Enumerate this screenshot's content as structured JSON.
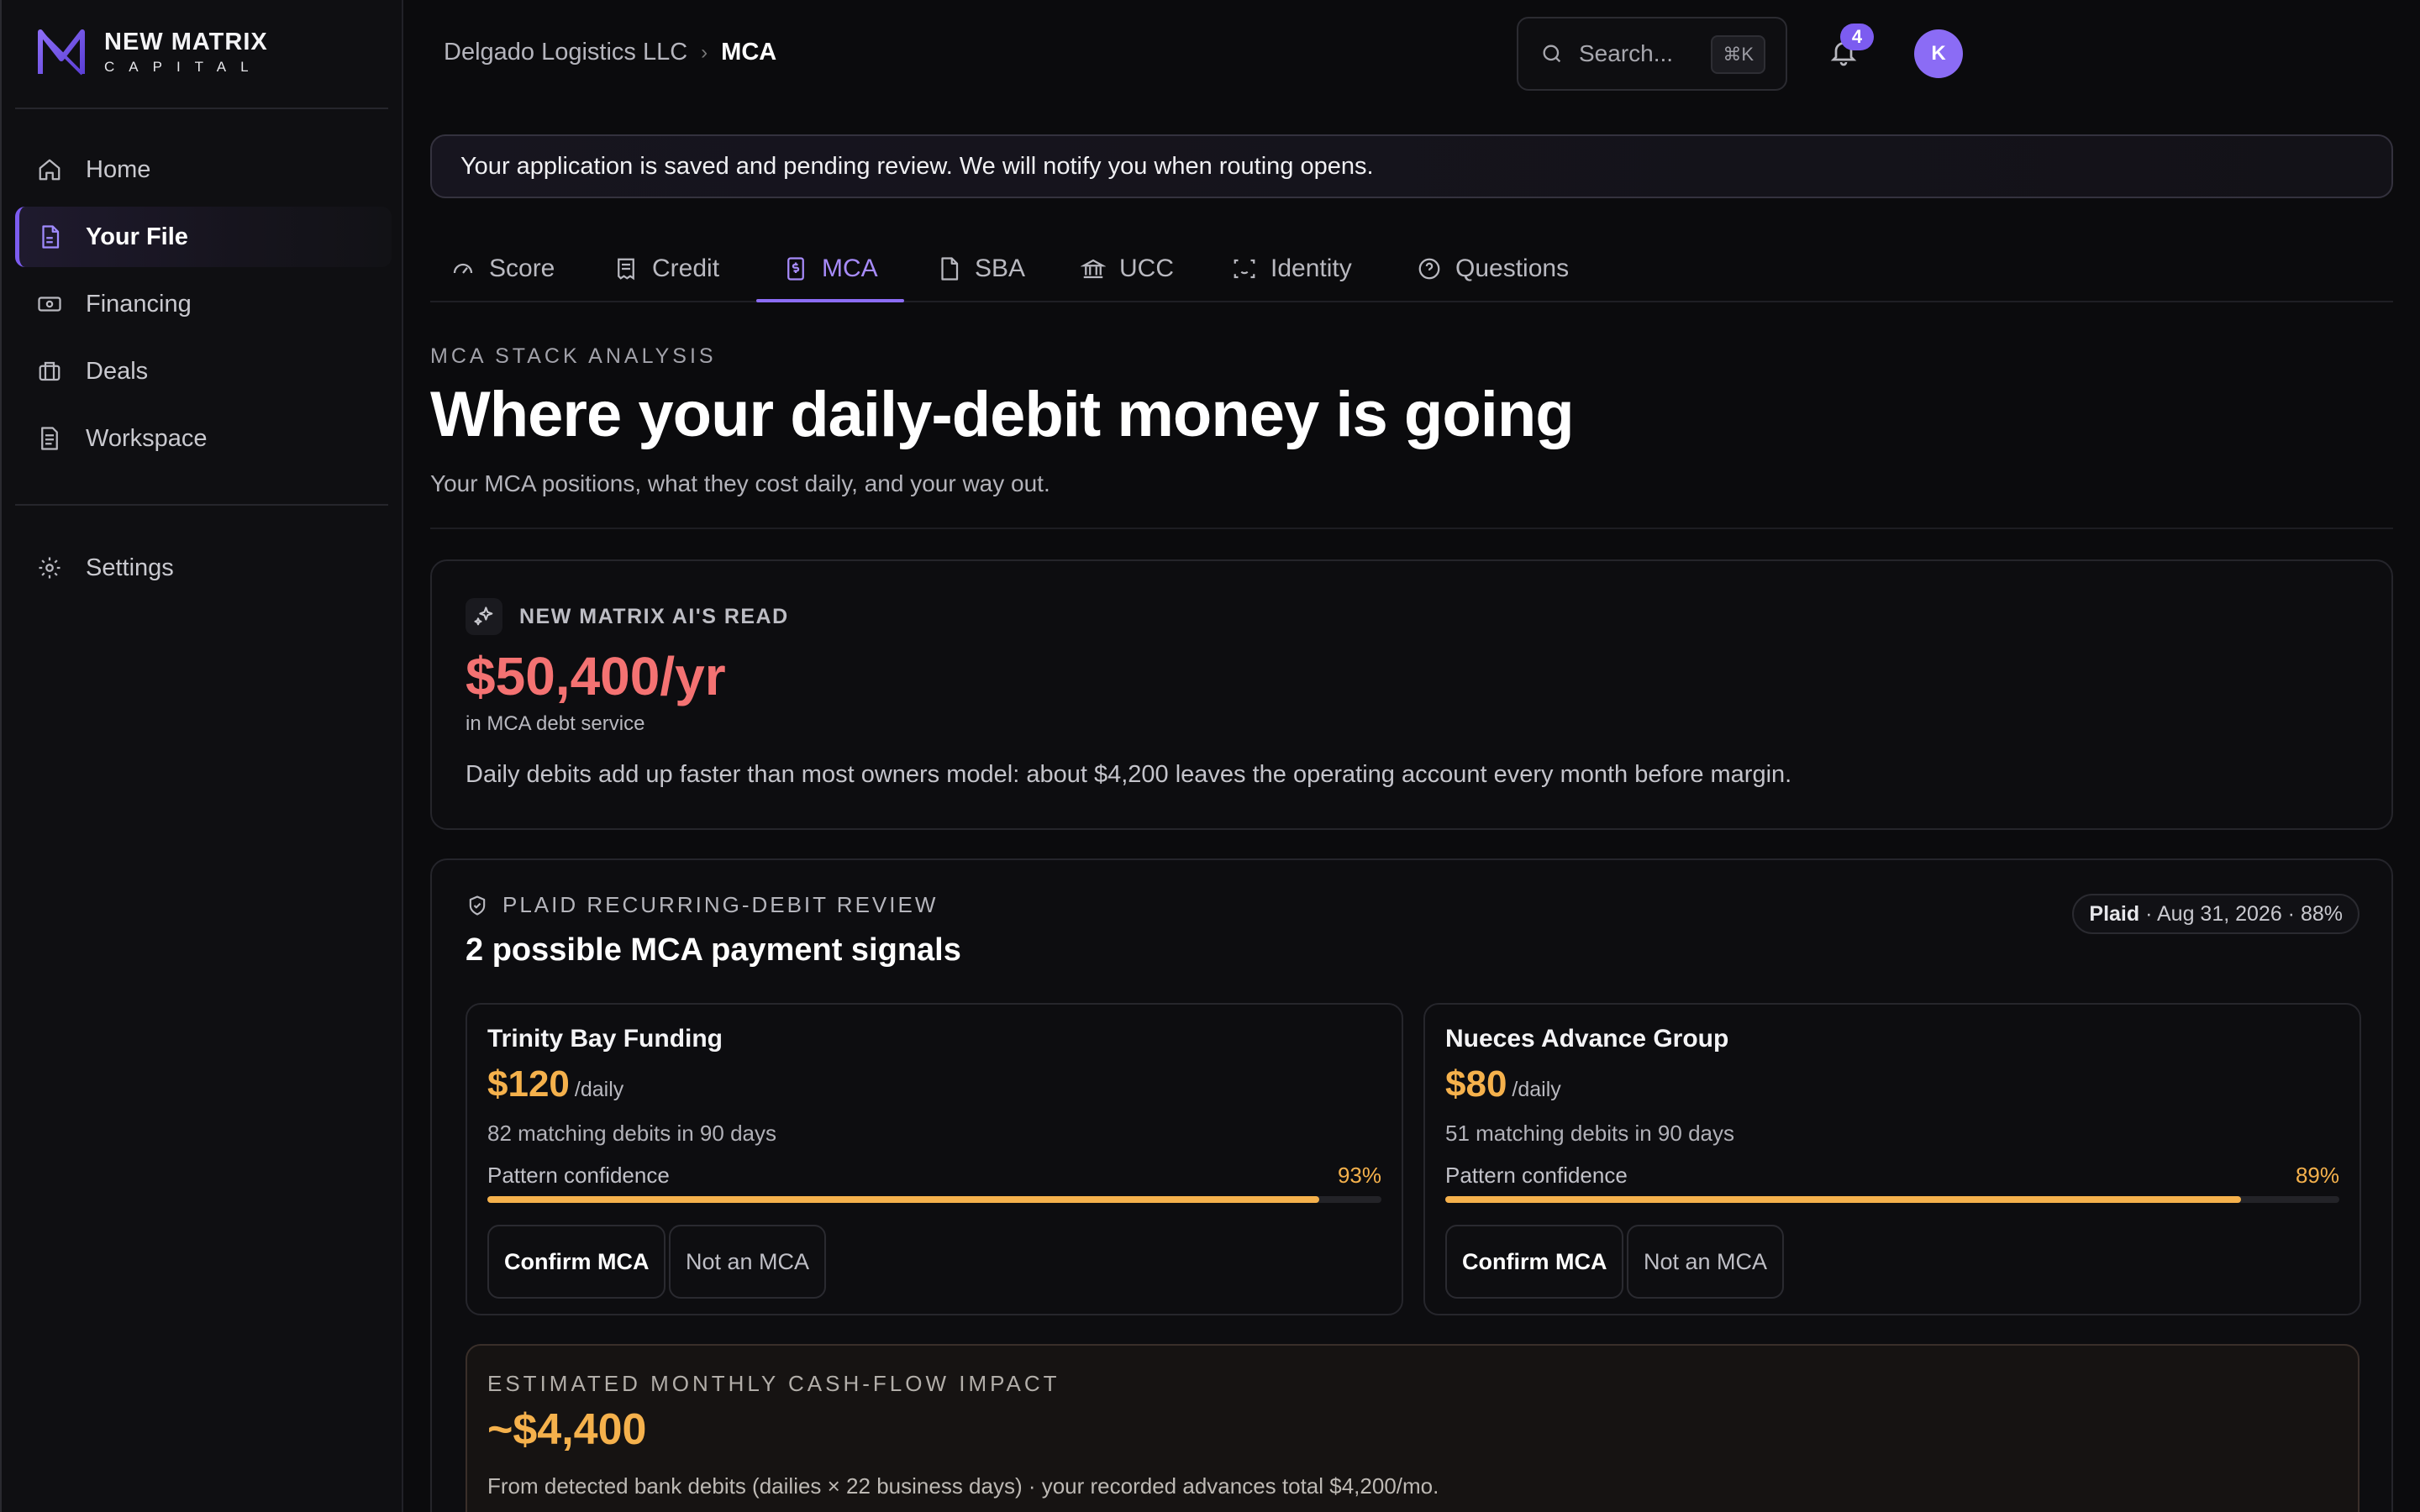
{
  "brand": {
    "name": "NEW MATRIX",
    "tagline": "CAPITAL",
    "accent": "#7c5cf0"
  },
  "sidebar": {
    "items": [
      {
        "label": "Home",
        "icon": "home-icon"
      },
      {
        "label": "Your File",
        "icon": "file-icon",
        "active": true
      },
      {
        "label": "Financing",
        "icon": "banknote-icon"
      },
      {
        "label": "Deals",
        "icon": "briefcase-icon"
      },
      {
        "label": "Workspace",
        "icon": "document-icon"
      }
    ],
    "settings": {
      "label": "Settings",
      "icon": "gear-icon"
    }
  },
  "header": {
    "breadcrumb": [
      "Delgado Logistics LLC",
      "MCA"
    ],
    "search_placeholder": "Search...",
    "search_shortcut": "⌘K",
    "notification_count": "4",
    "avatar_initial": "K"
  },
  "banner": "Your application is saved and pending review. We will notify you when routing opens.",
  "tabs": [
    {
      "label": "Score",
      "icon": "gauge-icon"
    },
    {
      "label": "Credit",
      "icon": "receipt-icon"
    },
    {
      "label": "MCA",
      "icon": "dollar-file-icon",
      "active": true
    },
    {
      "label": "SBA",
      "icon": "file-icon"
    },
    {
      "label": "UCC",
      "icon": "bank-icon"
    },
    {
      "label": "Identity",
      "icon": "scan-face-icon"
    },
    {
      "label": "Questions",
      "icon": "help-circle-icon"
    }
  ],
  "page": {
    "eyebrow": "MCA STACK ANALYSIS",
    "title": "Where your daily-debit money is going",
    "subtitle": "Your MCA positions, what they cost daily, and your way out."
  },
  "ai_read": {
    "label": "NEW MATRIX AI'S READ",
    "amount": "$50,400/yr",
    "caption": "in MCA debt service",
    "text": "Daily debits add up faster than most owners model: about $4,200 leaves the operating account every month before margin.",
    "amount_color": "#f47272"
  },
  "plaid_review": {
    "label": "PLAID RECURRING-DEBIT REVIEW",
    "title": "2 possible MCA payment signals",
    "meta_source": "Plaid",
    "meta_rest": " · Aug 31, 2026 · 88%",
    "signals": [
      {
        "name": "Trinity Bay Funding",
        "amount": "$120",
        "period": "/daily",
        "matches": "82 matching debits in 90 days",
        "confidence_label": "Pattern confidence",
        "confidence": "93%",
        "confidence_value": 0.93,
        "confirm_label": "Confirm MCA",
        "reject_label": "Not an MCA"
      },
      {
        "name": "Nueces Advance Group",
        "amount": "$80",
        "period": "/daily",
        "matches": "51 matching debits in 90 days",
        "confidence_label": "Pattern confidence",
        "confidence": "89%",
        "confidence_value": 0.89,
        "confirm_label": "Confirm MCA",
        "reject_label": "Not an MCA"
      }
    ]
  },
  "impact": {
    "label": "ESTIMATED MONTHLY CASH-FLOW IMPACT",
    "amount": "~$4,400",
    "note": "From detected bank debits (dailies × 22 business days) · your recorded advances total $4,200/mo.",
    "amount_color": "#f5b14c"
  }
}
